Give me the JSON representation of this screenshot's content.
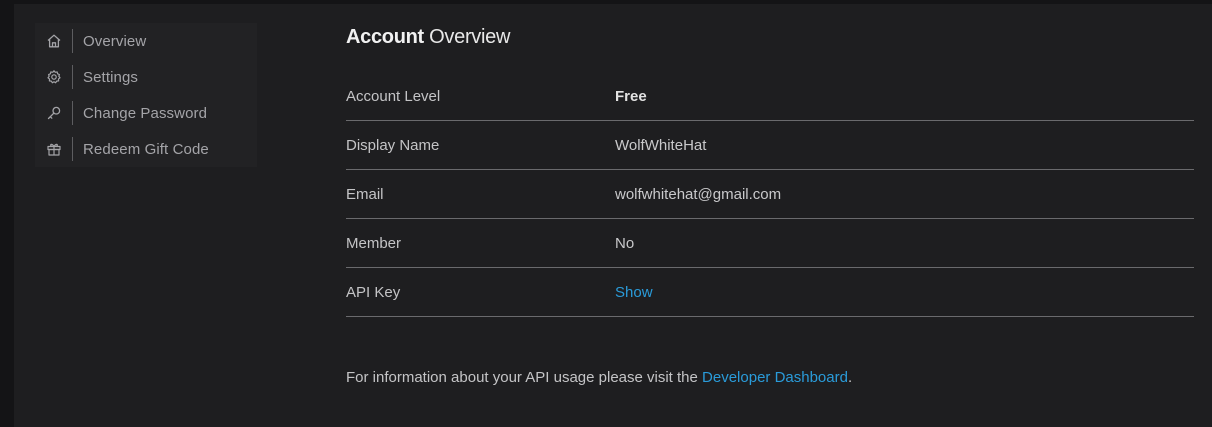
{
  "sidebar": {
    "items": [
      {
        "label": "Overview",
        "icon": "home-icon"
      },
      {
        "label": "Settings",
        "icon": "gear-icon"
      },
      {
        "label": "Change Password",
        "icon": "key-icon"
      },
      {
        "label": "Redeem Gift Code",
        "icon": "gift-icon"
      }
    ]
  },
  "main": {
    "title_bold": "Account",
    "title_light": "Overview",
    "rows": [
      {
        "label": "Account Level",
        "value": "Free"
      },
      {
        "label": "Display Name",
        "value": "WolfWhiteHat"
      },
      {
        "label": "Email",
        "value": "wolfwhitehat@gmail.com"
      },
      {
        "label": "Member",
        "value": "No"
      },
      {
        "label": "API Key",
        "value": "Show"
      }
    ],
    "info_text": "For information about your API usage please visit the ",
    "info_link": "Developer Dashboard",
    "info_end": "."
  },
  "colors": {
    "link": "#2a9bd9",
    "background": "#1e1e20"
  }
}
